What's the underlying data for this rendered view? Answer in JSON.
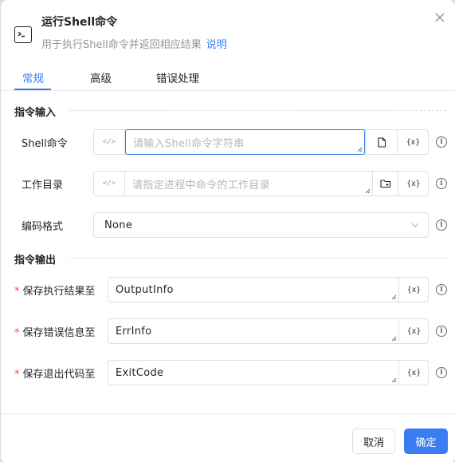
{
  "dialog": {
    "title": "运行Shell命令",
    "subtitle": "用于执行Shell命令并返回相应结果",
    "help_link": "说明"
  },
  "tabs": [
    {
      "label": "常规",
      "active": true
    },
    {
      "label": "高级",
      "active": false
    },
    {
      "label": "错误处理",
      "active": false
    }
  ],
  "input_section": {
    "heading": "指令输入",
    "shell_command": {
      "label": "Shell命令",
      "placeholder": "请输入Shell命令字符串",
      "value": ""
    },
    "working_dir": {
      "label": "工作目录",
      "placeholder": "请指定进程中命令的工作目录",
      "value": ""
    },
    "encoding": {
      "label": "编码格式",
      "value": "None"
    }
  },
  "output_section": {
    "heading": "指令输出",
    "result_var": {
      "label": "保存执行结果至",
      "value": "OutputInfo",
      "required": true
    },
    "error_var": {
      "label": "保存错误信息至",
      "value": "ErrInfo",
      "required": true
    },
    "exit_code_var": {
      "label": "保存退出代码至",
      "value": "ExitCode",
      "required": true
    }
  },
  "field_prefix_icon": "</>",
  "variable_button": "{x}",
  "info_icon": "i",
  "footer": {
    "cancel_label": "取消",
    "ok_label": "确定"
  },
  "colors": {
    "accent": "#3a7df0",
    "required": "#f54a45",
    "placeholder": "#b2b7be",
    "border": "#dcdfe4"
  }
}
